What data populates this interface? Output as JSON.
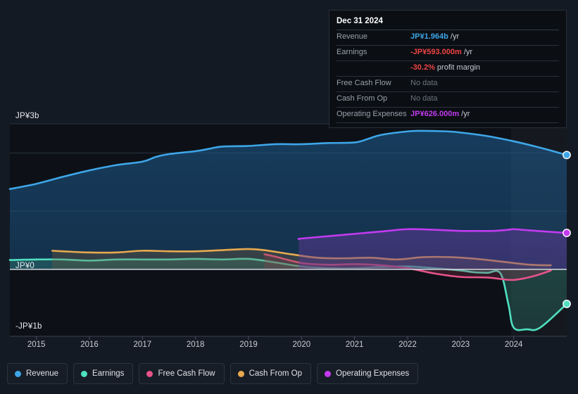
{
  "theme": {
    "background": "#141a23",
    "plot_background": "#0d1117",
    "gridline": "#2b3441",
    "zero_line": "#c9ced6",
    "axis_text": "#c9cdd4"
  },
  "tooltip": {
    "date": "Dec 31 2024",
    "rows": [
      {
        "name": "Revenue",
        "value": "JP¥1.964b",
        "unit": "/yr",
        "color": "#3ea6e8",
        "no_data": false
      },
      {
        "name": "Earnings",
        "value": "-JP¥593.000m",
        "unit": "/yr",
        "color": "#ef4444",
        "no_data": false
      },
      {
        "name": "",
        "value": "-30.2%",
        "unit": "profit margin",
        "color": "#ef4444",
        "no_data": false
      },
      {
        "name": "Free Cash Flow",
        "value": "No data",
        "unit": "",
        "color": "#6d737d",
        "no_data": true
      },
      {
        "name": "Cash From Op",
        "value": "No data",
        "unit": "",
        "color": "#6d737d",
        "no_data": true
      },
      {
        "name": "Operating Expenses",
        "value": "JP¥626.000m",
        "unit": "/yr",
        "color": "#c23bf0",
        "no_data": false
      }
    ]
  },
  "legend": {
    "items": [
      {
        "label": "Revenue",
        "color": "#3ea6e8"
      },
      {
        "label": "Earnings",
        "color": "#4fe0c0"
      },
      {
        "label": "Free Cash Flow",
        "color": "#e8538a"
      },
      {
        "label": "Cash From Op",
        "color": "#e8a94f"
      },
      {
        "label": "Operating Expenses",
        "color": "#c23bf0"
      }
    ]
  },
  "chart_data": {
    "type": "area",
    "title": "",
    "xlabel": "",
    "ylabel": "",
    "currency": "JPY",
    "grid": true,
    "legend_position": "bottom",
    "ylim": [
      -1.15,
      2.5
    ],
    "xlim": [
      2014.5,
      2025.0
    ],
    "y_ticks": [
      {
        "value": 3,
        "label": "JP¥3b"
      },
      {
        "value": 0,
        "label": "JP¥0"
      },
      {
        "value": -1,
        "label": "-JP¥1b"
      }
    ],
    "x_ticks": [
      {
        "value": 2015,
        "label": "2015"
      },
      {
        "value": 2016,
        "label": "2016"
      },
      {
        "value": 2017,
        "label": "2017"
      },
      {
        "value": 2018,
        "label": "2018"
      },
      {
        "value": 2019,
        "label": "2019"
      },
      {
        "value": 2020,
        "label": "2020"
      },
      {
        "value": 2021,
        "label": "2021"
      },
      {
        "value": 2022,
        "label": "2022"
      },
      {
        "value": 2023,
        "label": "2023"
      },
      {
        "value": 2024,
        "label": "2024"
      }
    ],
    "gridlines_y": [
      2.0,
      1.0,
      0.0
    ],
    "highlight_band": {
      "from": 2023.95,
      "to": 2025.0
    },
    "series": [
      {
        "name": "Revenue",
        "color": "#3ea6e8",
        "fill": "rgba(30,95,150,0.55)",
        "x": [
          2014.5,
          2015.0,
          2015.5,
          2016.0,
          2016.5,
          2017.0,
          2017.25,
          2017.5,
          2018.0,
          2018.25,
          2018.5,
          2019.0,
          2019.5,
          2020.0,
          2020.5,
          2021.0,
          2021.25,
          2021.5,
          2022.0,
          2022.25,
          2022.75,
          2023.0,
          2023.5,
          2024.0,
          2024.5,
          2025.0
        ],
        "values": [
          1.38,
          1.47,
          1.59,
          1.7,
          1.79,
          1.85,
          1.93,
          1.98,
          2.03,
          2.07,
          2.11,
          2.12,
          2.15,
          2.15,
          2.17,
          2.18,
          2.24,
          2.31,
          2.37,
          2.38,
          2.37,
          2.35,
          2.29,
          2.2,
          2.09,
          1.964
        ]
      },
      {
        "name": "Earnings",
        "color": "#4fe0c0",
        "fill": "rgba(46,120,110,0.45)",
        "x": [
          2014.5,
          2015.0,
          2015.5,
          2016.0,
          2016.5,
          2017.0,
          2017.5,
          2018.0,
          2018.5,
          2019.0,
          2019.5,
          2020.0,
          2020.5,
          2021.0,
          2021.5,
          2022.0,
          2022.5,
          2023.0,
          2023.25,
          2023.5,
          2023.75,
          2023.9,
          2024.0,
          2024.25,
          2024.5,
          2025.0
        ],
        "values": [
          0.16,
          0.17,
          0.17,
          0.15,
          0.17,
          0.17,
          0.17,
          0.18,
          0.17,
          0.18,
          0.12,
          0.05,
          0.02,
          0.02,
          0.04,
          0.05,
          0.02,
          -0.02,
          -0.05,
          -0.06,
          -0.07,
          -0.6,
          -1.0,
          -1.03,
          -1.0,
          -0.593
        ]
      },
      {
        "name": "Free Cash Flow",
        "color": "#e8538a",
        "fill": "rgba(150,50,80,0.35)",
        "x": [
          2019.3,
          2019.5,
          2020.0,
          2020.5,
          2021.0,
          2021.5,
          2022.0,
          2022.5,
          2023.0,
          2023.5,
          2023.9,
          2024.1,
          2024.4,
          2024.7
        ],
        "values": [
          0.26,
          0.22,
          0.11,
          0.08,
          0.09,
          0.07,
          0.02,
          -0.07,
          -0.13,
          -0.14,
          -0.18,
          -0.17,
          -0.11,
          -0.02
        ]
      },
      {
        "name": "Cash From Op",
        "color": "#e8a94f",
        "fill": "rgba(120,95,55,0.35)",
        "x": [
          2015.3,
          2015.5,
          2016.0,
          2016.5,
          2017.0,
          2017.5,
          2018.0,
          2018.5,
          2019.0,
          2019.3,
          2019.8,
          2020.3,
          2020.8,
          2021.3,
          2021.8,
          2022.3,
          2022.8,
          2023.3,
          2023.8,
          2024.3,
          2024.7
        ],
        "values": [
          0.32,
          0.31,
          0.29,
          0.29,
          0.32,
          0.31,
          0.31,
          0.33,
          0.35,
          0.33,
          0.26,
          0.2,
          0.19,
          0.2,
          0.17,
          0.21,
          0.21,
          0.18,
          0.13,
          0.08,
          0.07
        ]
      },
      {
        "name": "Operating Expenses",
        "color": "#c23bf0",
        "fill": "rgba(95,55,150,0.55)",
        "x": [
          2019.95,
          2020.0,
          2020.5,
          2021.0,
          2021.5,
          2022.0,
          2022.5,
          2023.0,
          2023.3,
          2023.6,
          2023.9,
          2024.0,
          2024.3,
          2024.6,
          2025.0
        ],
        "values": [
          0.52,
          0.53,
          0.57,
          0.61,
          0.65,
          0.69,
          0.68,
          0.66,
          0.66,
          0.66,
          0.68,
          0.69,
          0.67,
          0.65,
          0.626
        ]
      }
    ],
    "end_markers": [
      {
        "name": "Revenue",
        "x": 2025.0,
        "value": 1.964,
        "color": "#3ea6e8"
      },
      {
        "name": "Operating Expenses",
        "x": 2025.0,
        "value": 0.626,
        "color": "#c23bf0"
      },
      {
        "name": "Earnings",
        "x": 2025.0,
        "value": -0.593,
        "color": "#4fe0c0"
      }
    ]
  }
}
